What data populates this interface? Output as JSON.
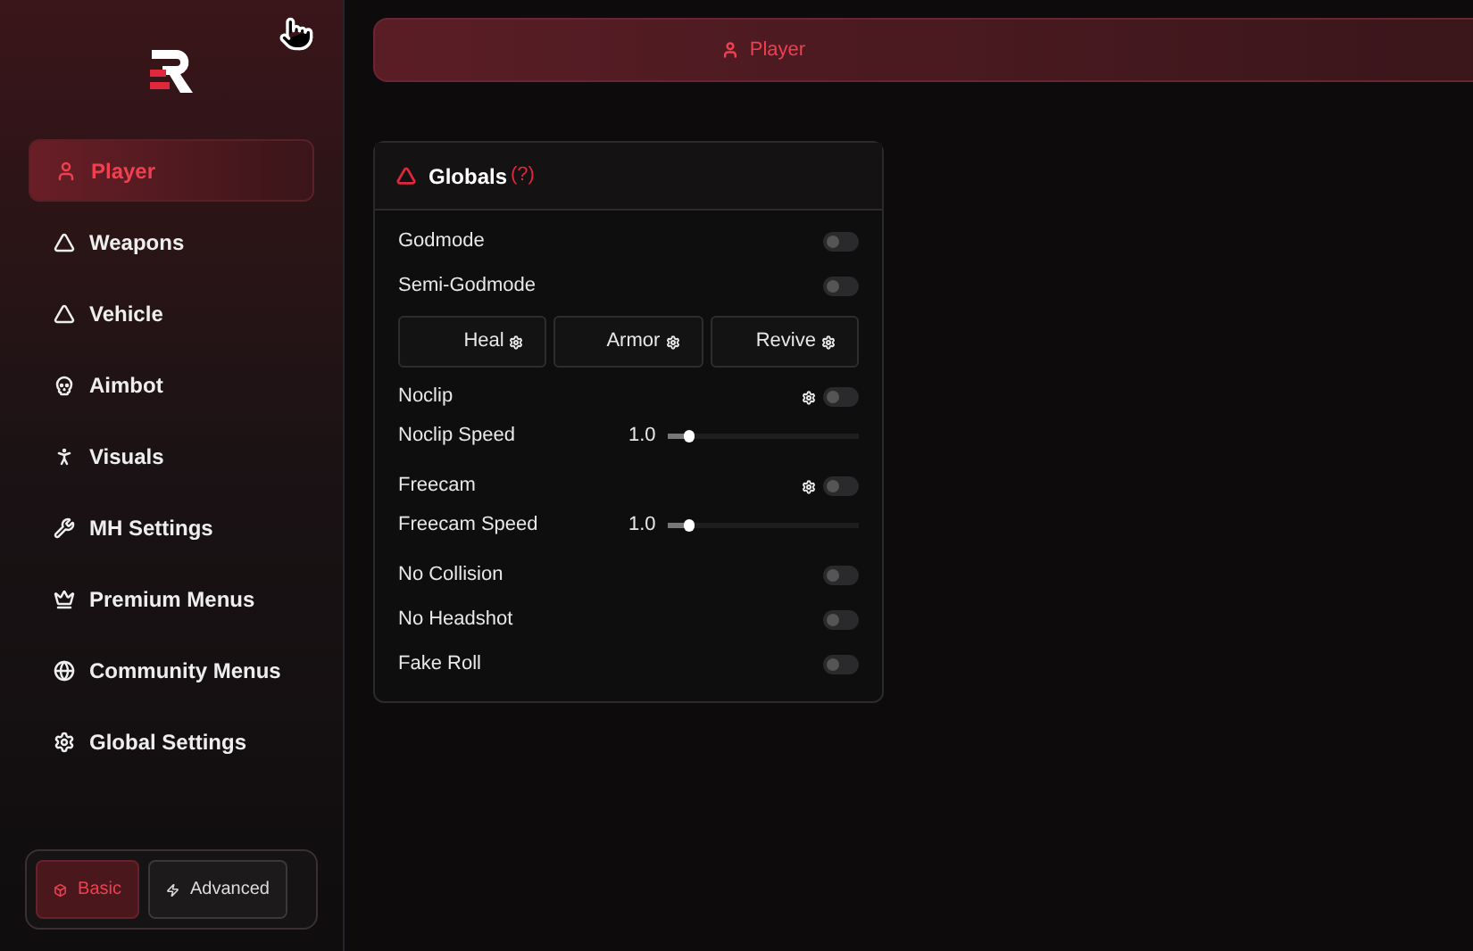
{
  "sidebar": {
    "items": [
      {
        "label": "Player",
        "selected": true
      },
      {
        "label": "Weapons",
        "selected": false
      },
      {
        "label": "Vehicle",
        "selected": false
      },
      {
        "label": "Aimbot",
        "selected": false
      },
      {
        "label": "Visuals",
        "selected": false
      },
      {
        "label": "MH Settings",
        "selected": false
      },
      {
        "label": "Premium Menus",
        "selected": false
      },
      {
        "label": "Community Menus",
        "selected": false
      },
      {
        "label": "Global Settings",
        "selected": false
      }
    ],
    "modes": [
      {
        "label": "Basic",
        "selected": true
      },
      {
        "label": "Advanced",
        "selected": false
      }
    ]
  },
  "header": {
    "title": "Player"
  },
  "panel": {
    "title": "Globals",
    "help": "(?)",
    "rows": [
      {
        "kind": "toggle",
        "label": "Godmode",
        "on": false,
        "gear": false
      },
      {
        "kind": "toggle",
        "label": "Semi-Godmode",
        "on": false,
        "gear": false
      },
      {
        "kind": "buttons",
        "buttons": [
          "Heal",
          "Armor",
          "Revive"
        ]
      },
      {
        "kind": "toggle",
        "label": "Noclip",
        "on": false,
        "gear": true
      },
      {
        "kind": "slider",
        "label": "Noclip Speed",
        "reading": "1.0",
        "level": 0.11
      },
      {
        "kind": "toggle",
        "label": "Freecam",
        "on": false,
        "gear": true
      },
      {
        "kind": "slider",
        "label": "Freecam Speed",
        "reading": "1.0",
        "level": 0.11
      },
      {
        "kind": "toggle",
        "label": "No Collision",
        "on": false,
        "gear": false
      },
      {
        "kind": "toggle",
        "label": "No Headshot",
        "on": false,
        "gear": false
      },
      {
        "kind": "toggle",
        "label": "Fake Roll",
        "on": false,
        "gear": false
      }
    ]
  }
}
